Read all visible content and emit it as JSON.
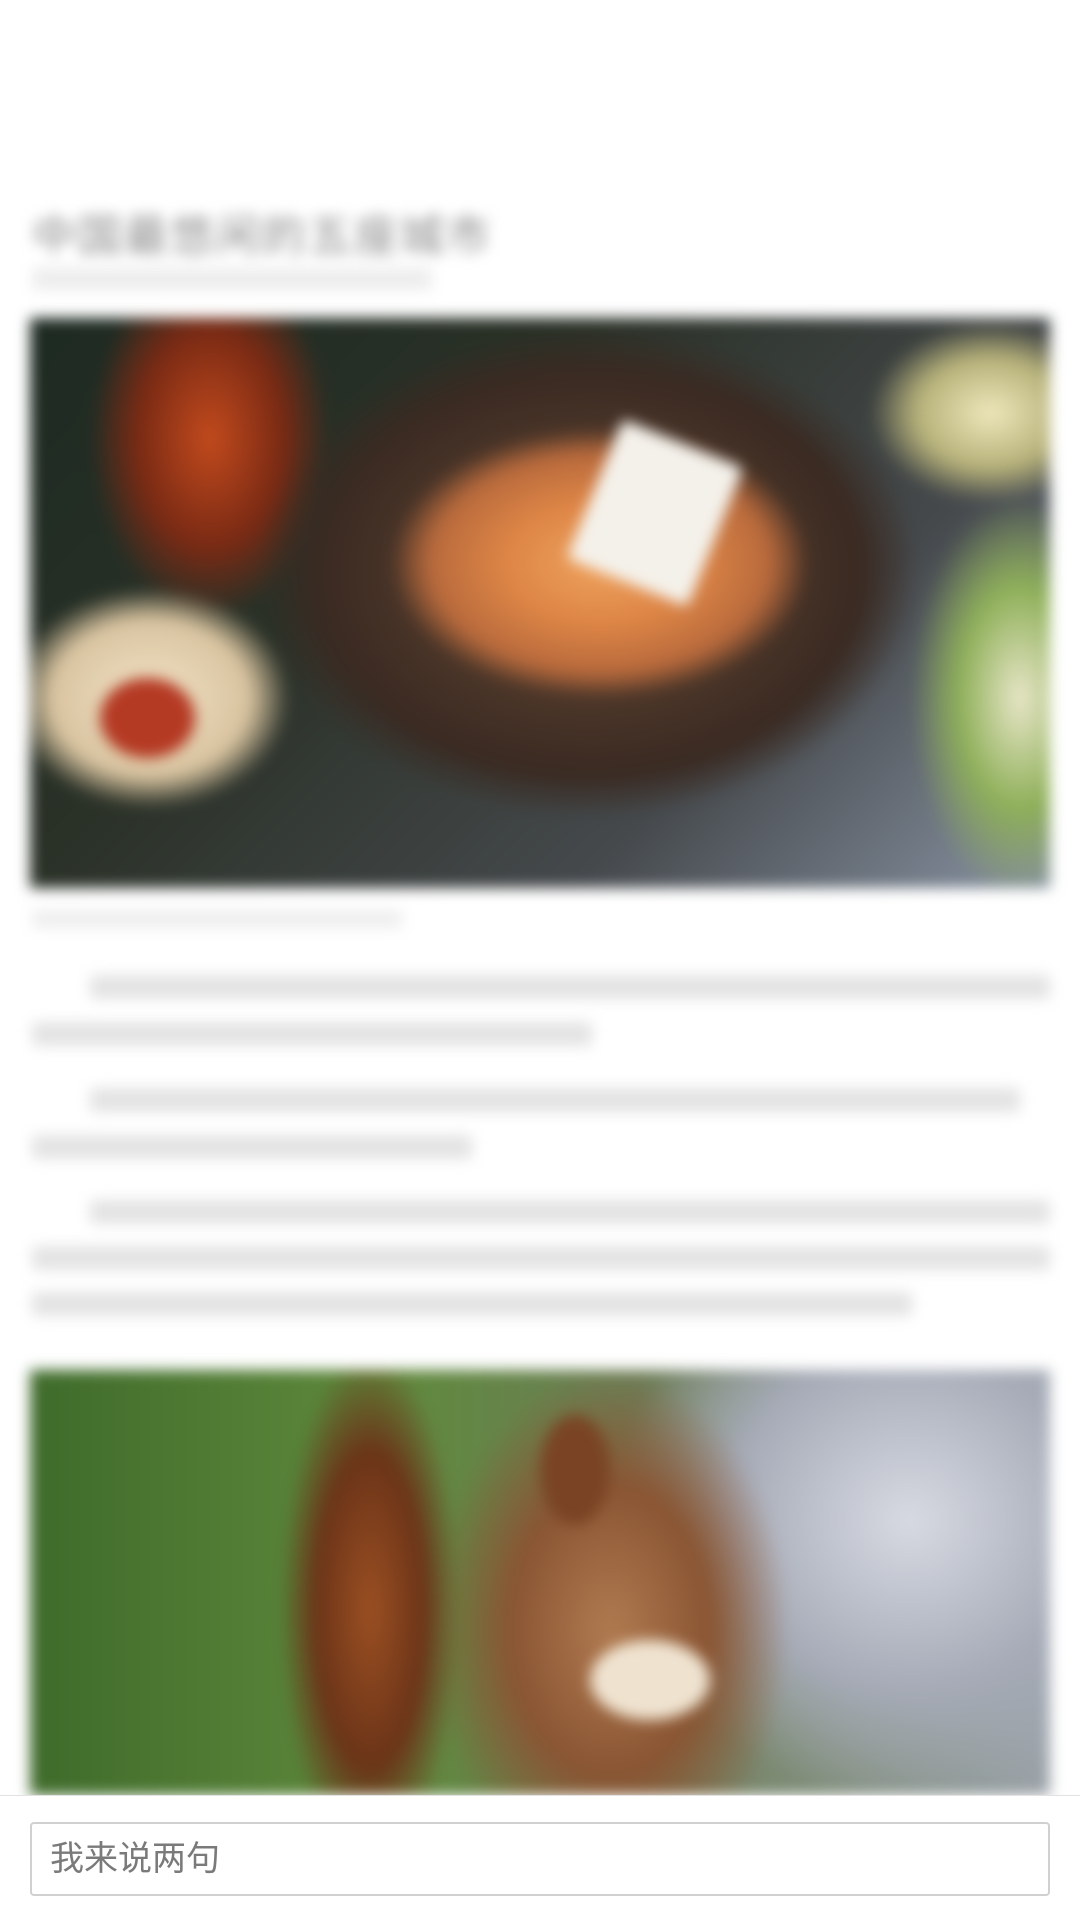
{
  "article": {
    "title": "中国最悠闲的五座城市"
  },
  "comment_bar": {
    "placeholder": "我来说两句"
  }
}
